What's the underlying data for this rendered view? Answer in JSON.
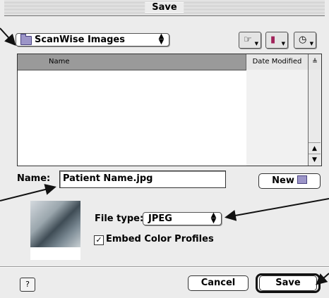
{
  "window": {
    "title": "Save"
  },
  "location_popup": {
    "value": "ScanWise Images"
  },
  "toolbar": {
    "shortcuts_icon": "pointing-hand-icon",
    "favorites_icon": "bookmark-folder-icon",
    "recent_icon": "clock-icon"
  },
  "file_list": {
    "columns": [
      "Name",
      "Date Modified"
    ],
    "sort_indicator": "≜",
    "rows": []
  },
  "name_field": {
    "label": "Name:",
    "value": "Patient Name.jpg"
  },
  "new_button": {
    "label": "New"
  },
  "file_type": {
    "label": "File type:",
    "value": "JPEG"
  },
  "embed_profiles": {
    "label": "Embed Color Profiles",
    "checked": true
  },
  "buttons": {
    "help": "?",
    "cancel": "Cancel",
    "save": "Save"
  }
}
